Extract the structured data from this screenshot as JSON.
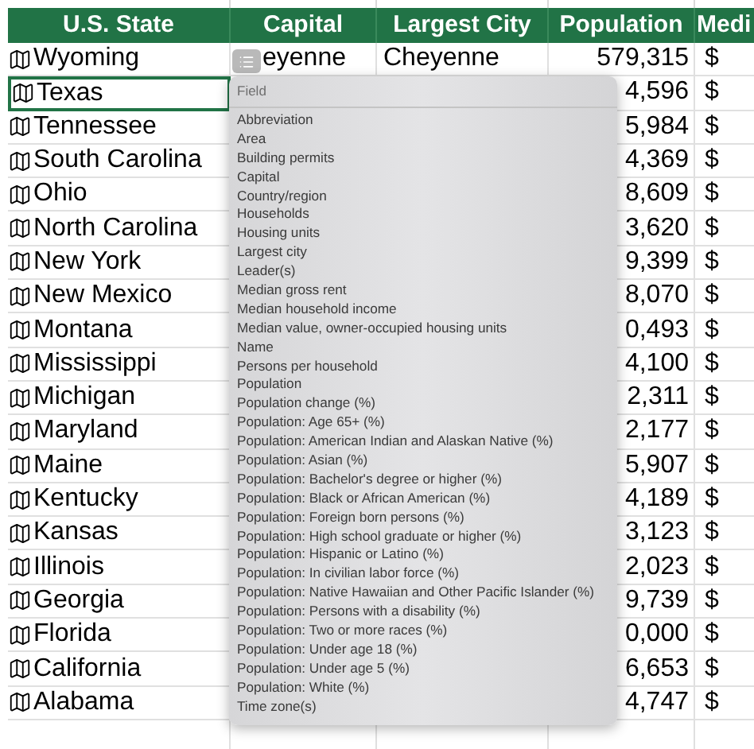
{
  "columns": [
    {
      "label": "U.S. State"
    },
    {
      "label": "Capital"
    },
    {
      "label": "Largest City"
    },
    {
      "label": "Population"
    },
    {
      "label": "Medi"
    }
  ],
  "rows": [
    {
      "state": "Wyoming",
      "selected": false,
      "capital": "eyenne",
      "largest_city": "Cheyenne",
      "population": "579,315",
      "column_5": "$"
    },
    {
      "state": "Texas",
      "selected": true,
      "population": "4,596",
      "column_5": "$"
    },
    {
      "state": "Tennessee",
      "selected": false,
      "population": "5,984",
      "column_5": "$"
    },
    {
      "state": "South Carolina",
      "selected": false,
      "population": "4,369",
      "column_5": "$"
    },
    {
      "state": "Ohio",
      "selected": false,
      "population": "8,609",
      "column_5": "$"
    },
    {
      "state": "North Carolina",
      "selected": false,
      "population": "3,620",
      "column_5": "$"
    },
    {
      "state": "New York",
      "selected": false,
      "population": "9,399",
      "column_5": "$"
    },
    {
      "state": "New Mexico",
      "selected": false,
      "population": "8,070",
      "column_5": "$"
    },
    {
      "state": "Montana",
      "selected": false,
      "population": "0,493",
      "column_5": "$"
    },
    {
      "state": "Mississippi",
      "selected": false,
      "population": "4,100",
      "column_5": "$"
    },
    {
      "state": "Michigan",
      "selected": false,
      "population": "2,311",
      "column_5": "$"
    },
    {
      "state": "Maryland",
      "selected": false,
      "population": "2,177",
      "column_5": "$"
    },
    {
      "state": "Maine",
      "selected": false,
      "population": "5,907",
      "column_5": "$"
    },
    {
      "state": "Kentucky",
      "selected": false,
      "population": "4,189",
      "column_5": "$"
    },
    {
      "state": "Kansas",
      "selected": false,
      "population": "3,123",
      "column_5": "$"
    },
    {
      "state": "Illinois",
      "selected": false,
      "population": "2,023",
      "column_5": "$"
    },
    {
      "state": "Georgia",
      "selected": false,
      "population": "9,739",
      "column_5": "$"
    },
    {
      "state": "Florida",
      "selected": false,
      "population": "0,000",
      "column_5": "$"
    },
    {
      "state": "California",
      "selected": false,
      "population": "6,653",
      "column_5": "$"
    },
    {
      "state": "Alabama",
      "selected": false,
      "population": "4,747",
      "column_5": "$"
    }
  ],
  "field_popup": {
    "header": "Field",
    "items": [
      "Abbreviation",
      "Area",
      "Building permits",
      "Capital",
      "Country/region",
      "Households",
      "Housing units",
      "Largest city",
      "Leader(s)",
      "Median gross rent",
      "Median household income",
      "Median value, owner-occupied housing units",
      "Name",
      "Persons per household",
      "Population",
      "Population change (%)",
      "Population: Age 65+ (%)",
      "Population: American Indian and Alaskan Native (%)",
      "Population: Asian (%)",
      "Population: Bachelor's degree or higher (%)",
      "Population: Black or African American (%)",
      "Population: Foreign born persons (%)",
      "Population: High school graduate or higher (%)",
      "Population: Hispanic or Latino (%)",
      "Population: In civilian labor force (%)",
      "Population: Native Hawaiian and Other Pacific Islander (%)",
      "Population: Persons with a disability (%)",
      "Population: Two or more races (%)",
      "Population: Under age 18 (%)",
      "Population: Under age 5 (%)",
      "Population: White (%)",
      "Time zone(s)"
    ]
  }
}
